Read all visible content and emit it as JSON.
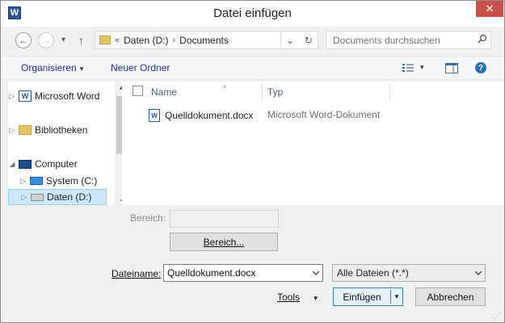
{
  "window": {
    "title": "Datei einfügen",
    "app_icon_letter": "W",
    "close_glyph": "✕"
  },
  "nav": {
    "back_glyph": "←",
    "forward_glyph": "→",
    "recent_glyph": "▾",
    "up_glyph": "↑",
    "address": {
      "overflow": "«",
      "segments": [
        "Daten (D:)",
        "Documents"
      ],
      "separator": "›",
      "dropdown_glyph": "⌄",
      "refresh_glyph": "↻"
    },
    "search": {
      "placeholder": "Documents durchsuchen",
      "icon": "search-icon"
    }
  },
  "toolbar": {
    "organize": "Organisieren",
    "organize_caret": "▾",
    "new_folder": "Neuer Ordner",
    "view_caret": "▾",
    "help_glyph": "?"
  },
  "nav_pane": {
    "items": [
      {
        "label": "Microsoft Word",
        "icon": "word-icon",
        "toggle": "▷",
        "selected": false
      },
      {
        "label": "Bibliotheken",
        "icon": "libraries-icon",
        "toggle": "▷",
        "selected": false
      },
      {
        "label": "Computer",
        "icon": "computer-icon",
        "toggle": "◢",
        "selected": false
      },
      {
        "label": "System (C:)",
        "icon": "system-drive-icon",
        "toggle": "▷",
        "selected": false
      },
      {
        "label": "Daten (D:)",
        "icon": "drive-icon",
        "toggle": "▷",
        "selected": true
      }
    ],
    "scroll_up": "▴",
    "scroll_down": "⌄"
  },
  "file_list": {
    "columns": [
      "Name",
      "Typ"
    ],
    "sort_glyph": "^",
    "files": [
      {
        "name": "Quelldokument.docx",
        "type": "Microsoft Word-Dokument",
        "icon": "word-document-icon",
        "icon_letter": "W"
      }
    ]
  },
  "range": {
    "label": "Bereich:",
    "button": "Bereich..."
  },
  "filename": {
    "label": "Dateiname:",
    "value": "Quelldokument.docx",
    "filter": "Alle Dateien (*.*)"
  },
  "actions": {
    "tools": "Tools",
    "tools_caret": "▾",
    "insert": "Einfügen",
    "insert_split": "▾",
    "cancel": "Abbrechen"
  },
  "colors": {
    "accent": "#1e3287",
    "selection": "#cce8ff",
    "close_red": "#c7504b"
  }
}
